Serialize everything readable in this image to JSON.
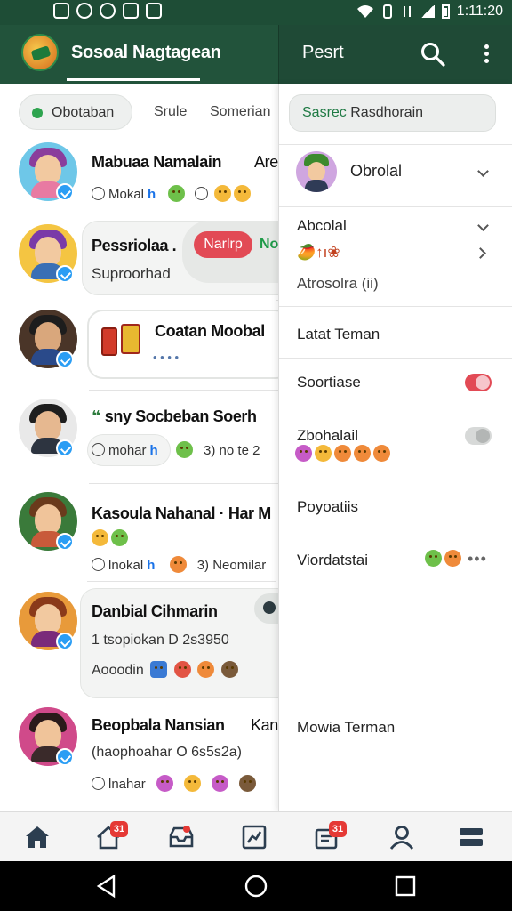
{
  "status_bar": {
    "time": "1:11:20",
    "icons": [
      "camera-icon",
      "clock-icon",
      "play-icon",
      "image-icon",
      "photo-icon",
      "wifi-icon",
      "vibrate-icon",
      "signal-icon",
      "battery-icon"
    ]
  },
  "app_bar": {
    "title": "Sosoal Nagtagean",
    "right_label": "Pesrt",
    "right_icons": [
      "search-icon",
      "more-vert-icon"
    ]
  },
  "filters": {
    "chip_label": "Obotaban",
    "tabs": [
      "Srule",
      "Somerian"
    ]
  },
  "friends": [
    {
      "name": "Mabuaa Namalain",
      "name_extra": "Are",
      "meta_text": "Mokal",
      "meta_tag": "h"
    },
    {
      "name": "Pessriolaa",
      "name_suffix": ".",
      "subtitle": "Suproorhad",
      "button_label": "Narlrp",
      "overflow_text": "No"
    },
    {
      "name": "Coatan Moobal",
      "meta_text": "• • • •"
    },
    {
      "name": "sny Socbeban Soerh",
      "name_prefix": "❝",
      "meta_text": "mohar",
      "meta_tag": "h",
      "meta_extra": "3) no te 2"
    },
    {
      "name": "Kasoula Nahanal · Har M",
      "meta_text": "lnokal",
      "meta_tag": "h",
      "meta_extra": "3) Neomilar"
    },
    {
      "name": "Danbial Cihmarin",
      "subtitle": "1 tsopiokan D 2s3950",
      "meta_text": "Aooodin"
    },
    {
      "name": "Beopbala Nansian",
      "name_extra": "Kan",
      "subtitle": "(haophoahar O 6s5s2a)",
      "meta_text": "lnahar"
    }
  ],
  "right_panel": {
    "search_prefix": "Sasrec",
    "search_text": "Rasdhorain",
    "profile_name": "Obrolal",
    "section_title": "Abcolal",
    "section_emoji_text": "🥭↑ı❀",
    "section_subtitle": "Atrosolra (ii)",
    "menu": [
      {
        "label": "Latat Teman"
      },
      {
        "label": "Soortiase",
        "toggle": "on"
      },
      {
        "label": "Zbohalail",
        "toggle": "off"
      },
      {
        "label": "Poyoatiis"
      },
      {
        "label": "Viordatstai"
      },
      {
        "label": "Mowia Terman"
      }
    ]
  },
  "bottom_nav": {
    "items": [
      "home-icon",
      "house-alert-icon",
      "inbox-icon",
      "trending-icon",
      "messages-icon",
      "profile-icon",
      "menu-icon"
    ],
    "badges": {
      "house": "31",
      "messages": "31"
    }
  },
  "colors": {
    "app_bar": "#22533b",
    "accent_green": "#2ea44f",
    "toggle_on": "#e24a55",
    "verified": "#2a9df4",
    "badge": "#e53935"
  }
}
